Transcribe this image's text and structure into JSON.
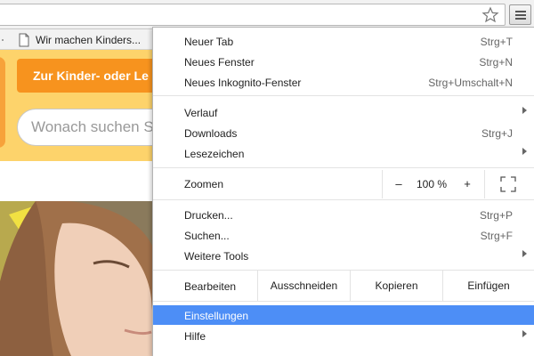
{
  "browser": {
    "bookmarks": [
      {
        "label": "Wir machen Kinders..."
      }
    ]
  },
  "page": {
    "cta_label": "Zur Kinder- oder Le",
    "search_placeholder": "Wonach suchen Sie"
  },
  "menu": {
    "items": [
      {
        "label": "Neuer Tab",
        "shortcut": "Strg+T"
      },
      {
        "label": "Neues Fenster",
        "shortcut": "Strg+N"
      },
      {
        "label": "Neues Inkognito-Fenster",
        "shortcut": "Strg+Umschalt+N"
      },
      {
        "label": "Verlauf",
        "shortcut": ""
      },
      {
        "label": "Downloads",
        "shortcut": "Strg+J"
      },
      {
        "label": "Lesezeichen",
        "shortcut": ""
      },
      {
        "label": "Drucken...",
        "shortcut": "Strg+P"
      },
      {
        "label": "Suchen...",
        "shortcut": "Strg+F"
      },
      {
        "label": "Weitere Tools",
        "shortcut": ""
      },
      {
        "label": "Einstellungen",
        "shortcut": ""
      },
      {
        "label": "Hilfe",
        "shortcut": ""
      }
    ],
    "zoom": {
      "label": "Zoomen",
      "minus": "–",
      "value": "100 %",
      "plus": "+"
    },
    "edit": {
      "label": "Bearbeiten",
      "cut": "Ausschneiden",
      "copy": "Kopieren",
      "paste": "Einfügen"
    }
  },
  "colors": {
    "highlight": "#4d8ef6",
    "header_yellow": "#fdd36b",
    "cta_orange": "#f7931e"
  },
  "icons": {
    "star": "star-icon",
    "menu": "hamburger-menu-icon",
    "page": "page-icon",
    "fullscreen": "fullscreen-icon"
  }
}
